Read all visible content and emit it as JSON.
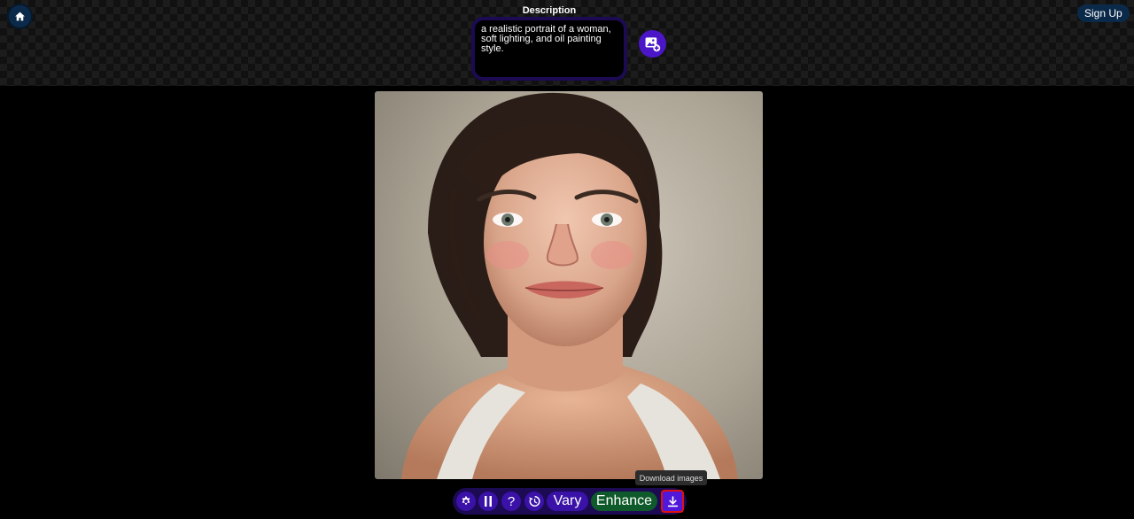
{
  "header": {
    "home_icon": "home-icon",
    "signup_label": "Sign Up"
  },
  "description": {
    "label": "Description",
    "value": "a realistic portrait of a woman, soft lighting, and oil painting style.",
    "add_image_icon": "add-image-icon"
  },
  "toolbar": {
    "settings_icon": "gear-icon",
    "pause_icon": "pause-icon",
    "help_label": "?",
    "history_icon": "history-icon",
    "vary_label": "Vary",
    "enhance_label": "Enhance",
    "download_icon": "download-icon",
    "download_tooltip": "Download images"
  },
  "colors": {
    "accent_purple": "#3a12a8",
    "enhance_green": "#0f5a2a",
    "signup_blue": "#0b2a4a",
    "highlight_red": "#e01010"
  }
}
